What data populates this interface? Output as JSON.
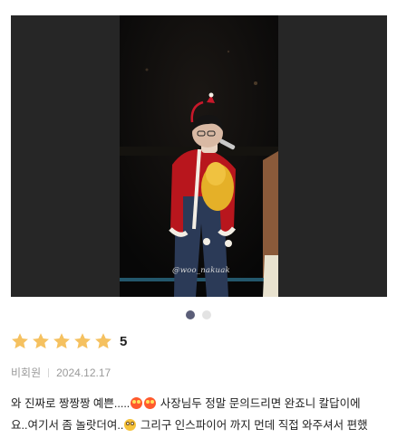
{
  "photo": {
    "watermark": "@woo_nakuak"
  },
  "carousel": {
    "count": 2,
    "active": 1
  },
  "rating": {
    "stars": 5,
    "value": "5",
    "star_color": "#f5c160"
  },
  "meta": {
    "author": "비회원",
    "date": "2024.12.17"
  },
  "review": {
    "line1_a": "와 진짜로 짱짱짱 예쁜.....",
    "line1_b": " 사장님두 정말 문의드리면 완죠니 칼답이에",
    "line2_a": "요..여기서 좀 놀랏더여..",
    "line2_b": " 그리구 인스파이어 까지 먼데 직접 와주셔서 편했",
    "emoji_1": "smiling-face-with-heart-eyes",
    "emoji_2": "flushed-face"
  }
}
